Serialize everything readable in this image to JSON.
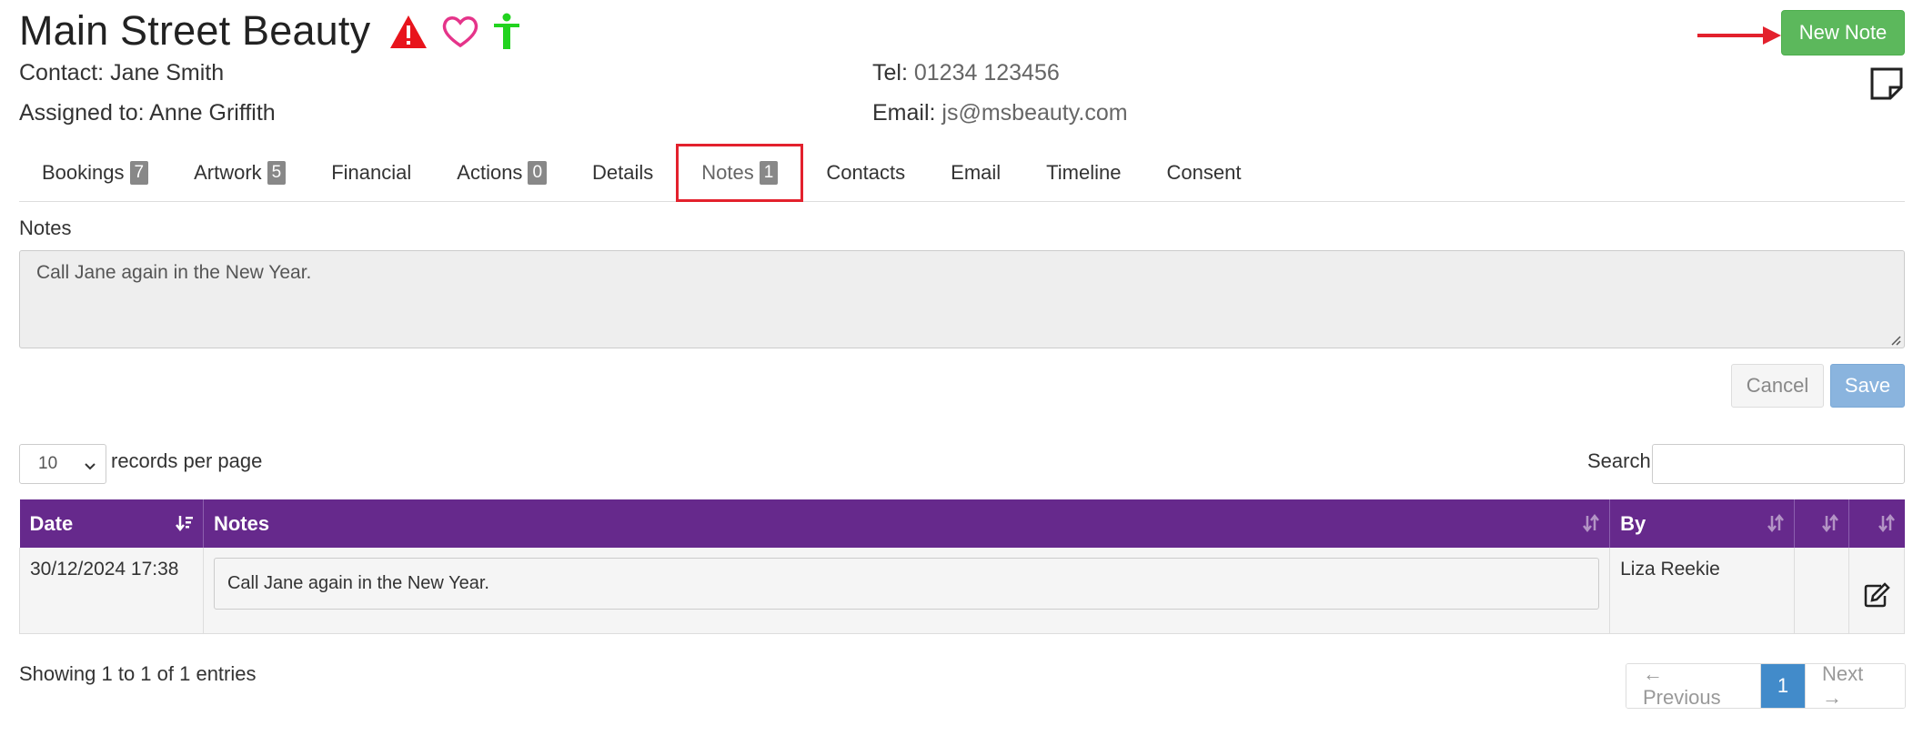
{
  "header": {
    "title": "Main Street Beauty",
    "icons": [
      "warning-icon",
      "heart-icon",
      "accessibility-icon"
    ],
    "contact_label": "Contact:",
    "contact_name": "Jane Smith",
    "assigned_label": "Assigned to:",
    "assigned_name": "Anne Griffith",
    "tel_label": "Tel:",
    "tel_value": "01234 123456",
    "email_label": "Email:",
    "email_value": "js@msbeauty.com",
    "new_note_label": "New Note"
  },
  "tabs": [
    {
      "label": "Bookings",
      "badge": "7"
    },
    {
      "label": "Artwork",
      "badge": "5"
    },
    {
      "label": "Financial",
      "badge": ""
    },
    {
      "label": "Actions",
      "badge": "0"
    },
    {
      "label": "Details",
      "badge": ""
    },
    {
      "label": "Notes",
      "badge": "1",
      "active": true
    },
    {
      "label": "Contacts",
      "badge": ""
    },
    {
      "label": "Email",
      "badge": ""
    },
    {
      "label": "Timeline",
      "badge": ""
    },
    {
      "label": "Consent",
      "badge": ""
    }
  ],
  "notes_editor": {
    "label": "Notes",
    "value": "Call Jane again in the New Year.",
    "cancel_label": "Cancel",
    "save_label": "Save"
  },
  "table_controls": {
    "page_length": "10",
    "length_label": "records per page",
    "search_label": "Search:"
  },
  "table": {
    "columns": [
      "Date",
      "Notes",
      "By",
      "",
      ""
    ],
    "rows": [
      {
        "date": "30/12/2024 17:38",
        "note": "Call Jane again in the New Year.",
        "by": "Liza Reekie"
      }
    ]
  },
  "footer": {
    "showing": "Showing 1 to 1 of 1 entries",
    "prev_label": "← Previous",
    "current_page": "1",
    "next_label": "Next →"
  },
  "colors": {
    "header_bg": "#66298c",
    "new_note_bg": "#5cb85c",
    "save_bg": "#8ab4de",
    "highlight_red": "#e3212d",
    "page_current": "#428bca"
  }
}
